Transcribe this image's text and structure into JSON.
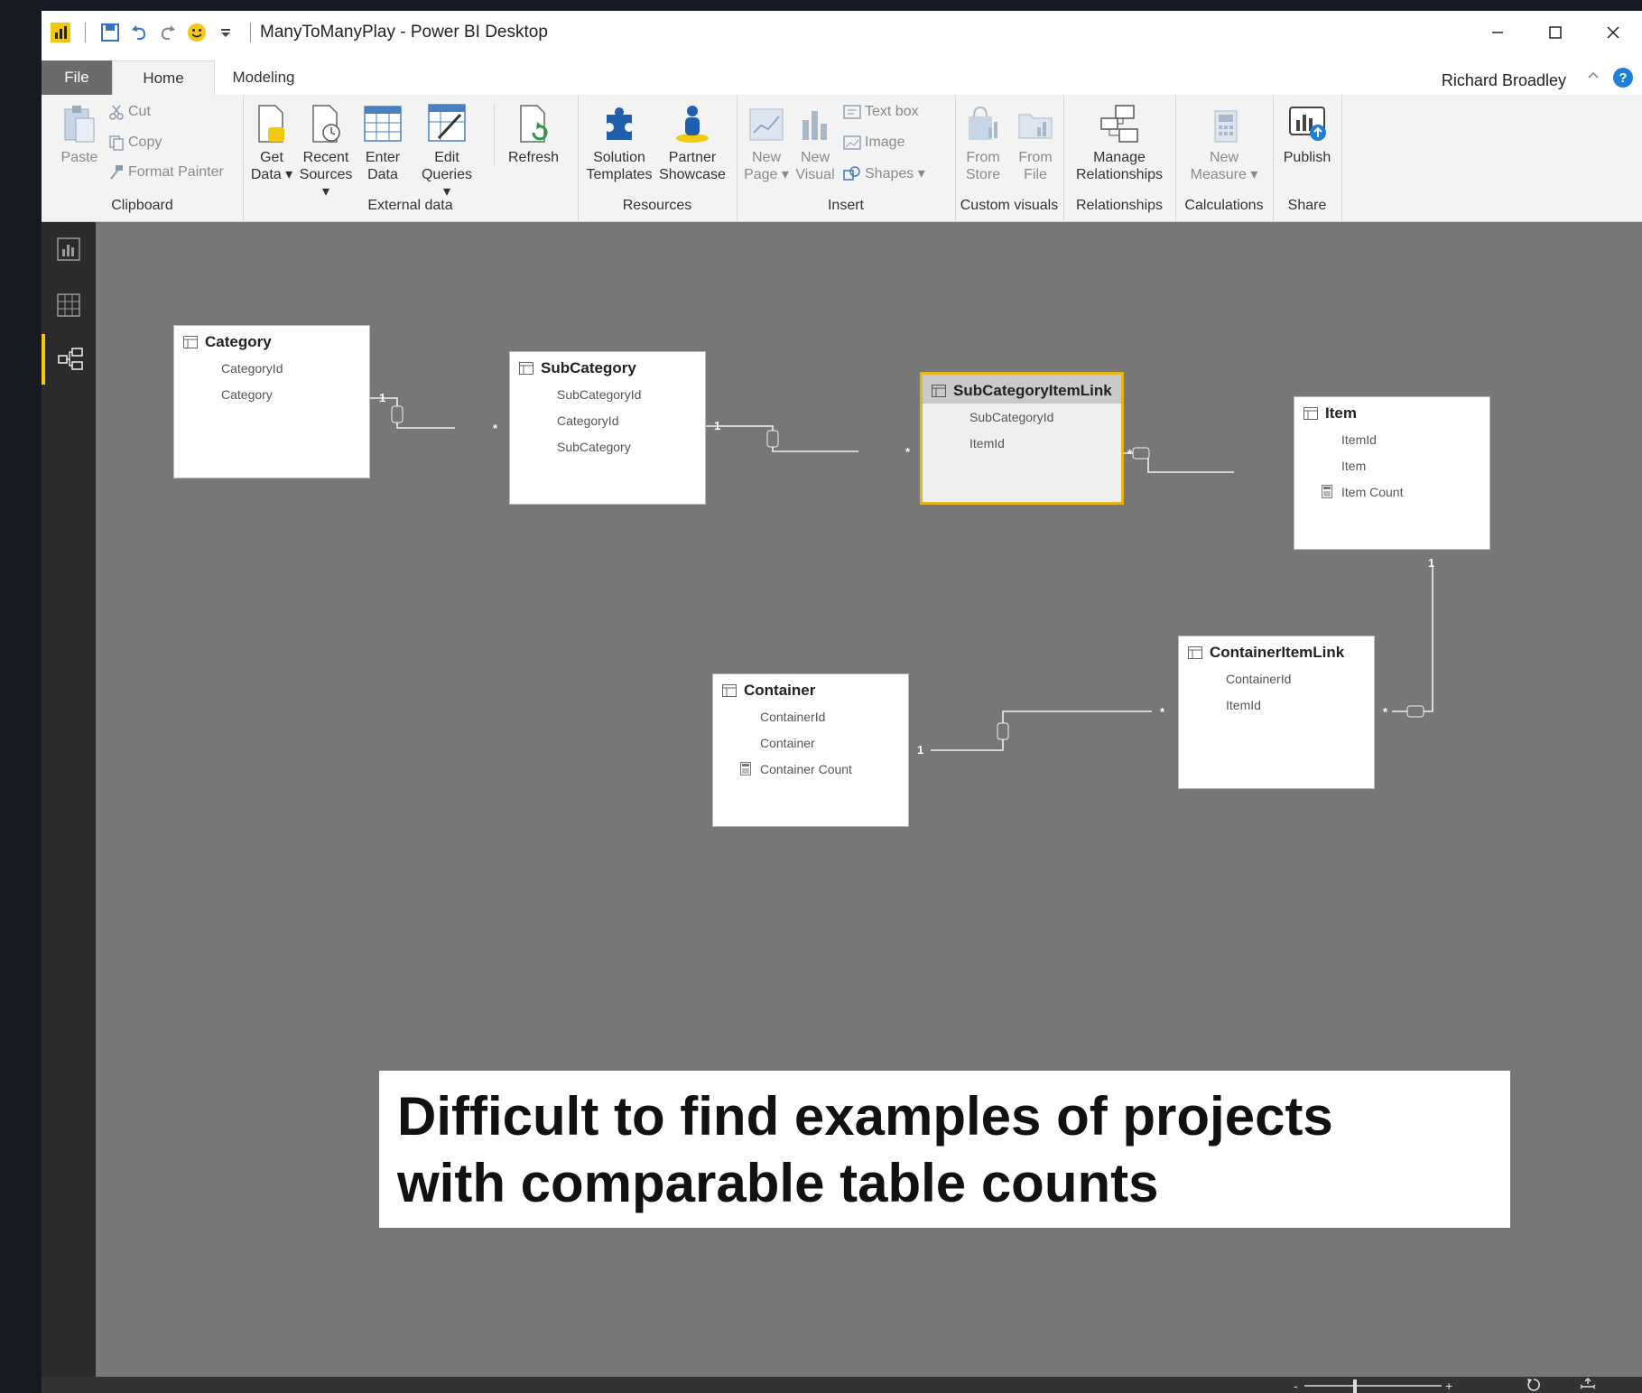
{
  "window": {
    "title": "ManyToManyPlay - Power BI Desktop",
    "user": "Richard Broadley"
  },
  "tabs": [
    {
      "label": "File"
    },
    {
      "label": "Home"
    },
    {
      "label": "Modeling"
    }
  ],
  "ribbon": {
    "clipboard": {
      "label": "Clipboard",
      "paste": "Paste",
      "cut": "Cut",
      "copy": "Copy",
      "format_painter": "Format Painter"
    },
    "external_data": {
      "label": "External data",
      "get_data": [
        "Get",
        "Data ▾"
      ],
      "recent_sources": [
        "Recent",
        "Sources ▾"
      ],
      "enter_data": [
        "Enter",
        "Data"
      ],
      "edit_queries": [
        "Edit",
        "Queries ▾"
      ],
      "refresh": "Refresh"
    },
    "resources": {
      "label": "Resources",
      "solution_templates": [
        "Solution",
        "Templates"
      ],
      "partner_showcase": [
        "Partner",
        "Showcase"
      ]
    },
    "insert": {
      "label": "Insert",
      "new_page": [
        "New",
        "Page ▾"
      ],
      "new_visual": [
        "New",
        "Visual"
      ],
      "text_box": "Text box",
      "image": "Image",
      "shapes": "Shapes ▾"
    },
    "custom_visuals": {
      "label": "Custom visuals",
      "from_store": [
        "From",
        "Store"
      ],
      "from_file": [
        "From",
        "File"
      ]
    },
    "relationships": {
      "label": "Relationships",
      "manage": [
        "Manage",
        "Relationships"
      ]
    },
    "calculations": {
      "label": "Calculations",
      "new_measure": [
        "New",
        "Measure ▾"
      ]
    },
    "share": {
      "label": "Share",
      "publish": "Publish"
    }
  },
  "tables": {
    "category": {
      "name": "Category",
      "fields": [
        "CategoryId",
        "Category"
      ]
    },
    "subcategory": {
      "name": "SubCategory",
      "fields": [
        "SubCategoryId",
        "CategoryId",
        "SubCategory"
      ]
    },
    "subcategoryitemlink": {
      "name": "SubCategoryItemLink",
      "fields": [
        "SubCategoryId",
        "ItemId"
      ]
    },
    "item": {
      "name": "Item",
      "fields": [
        "ItemId",
        "Item",
        "Item Count"
      ]
    },
    "containeritemlink": {
      "name": "ContainerItemLink",
      "fields": [
        "ContainerId",
        "ItemId"
      ]
    },
    "container": {
      "name": "Container",
      "fields": [
        "ContainerId",
        "Container",
        "Container Count"
      ]
    }
  },
  "cardinality": {
    "one": "1",
    "many": "*"
  },
  "callout": {
    "line1": "Difficult to find examples of projects",
    "line2": "with comparable table counts"
  },
  "colors": {
    "selection": "#e3b619",
    "canvas": "#777777",
    "accent": "#f2c811"
  }
}
